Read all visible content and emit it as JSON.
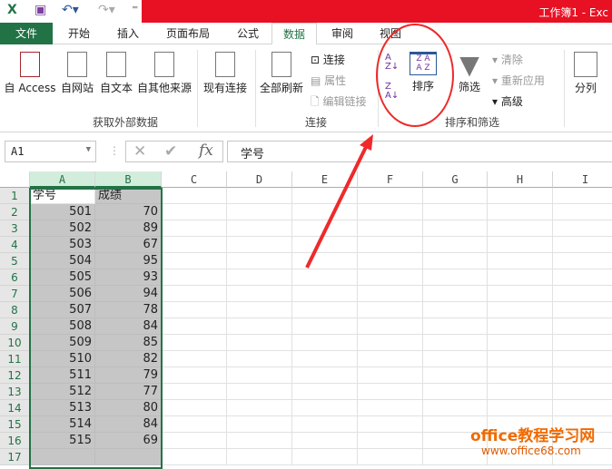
{
  "window": {
    "title": "工作簿1 - Exc"
  },
  "tabs": [
    "文件",
    "开始",
    "插入",
    "页面布局",
    "公式",
    "数据",
    "审阅",
    "视图"
  ],
  "ribbon": {
    "get_external": {
      "buttons": [
        "自 Access",
        "自网站",
        "自文本",
        "自其他来源"
      ],
      "label": "获取外部数据"
    },
    "existing": "现有连接",
    "connections": {
      "refresh_all": "全部刷新",
      "items": [
        "连接",
        "属性",
        "编辑链接"
      ],
      "label": "连接"
    },
    "sort_filter": {
      "sort": "排序",
      "filter": "筛选",
      "items": [
        "清除",
        "重新应用",
        "高级"
      ],
      "label": "排序和筛选"
    },
    "text_to_columns": "分列"
  },
  "formula_bar": {
    "name_box": "A1",
    "formula": "学号",
    "fx": "fx"
  },
  "columns": [
    "A",
    "B",
    "C",
    "D",
    "E",
    "F",
    "G",
    "H",
    "I"
  ],
  "rows": [
    [
      "学号",
      "成绩"
    ],
    [
      "501",
      "70"
    ],
    [
      "502",
      "89"
    ],
    [
      "503",
      "67"
    ],
    [
      "504",
      "95"
    ],
    [
      "505",
      "93"
    ],
    [
      "506",
      "94"
    ],
    [
      "507",
      "78"
    ],
    [
      "508",
      "84"
    ],
    [
      "509",
      "85"
    ],
    [
      "510",
      "82"
    ],
    [
      "511",
      "79"
    ],
    [
      "512",
      "77"
    ],
    [
      "513",
      "80"
    ],
    [
      "514",
      "84"
    ],
    [
      "515",
      "69"
    ],
    [
      "",
      ""
    ]
  ],
  "watermark": {
    "line1": "office教程学习网",
    "line2": "www.office68.com"
  },
  "colors": {
    "excel_green": "#217346",
    "title_red": "#e81123",
    "annotation_red": "#ee2a2a"
  }
}
